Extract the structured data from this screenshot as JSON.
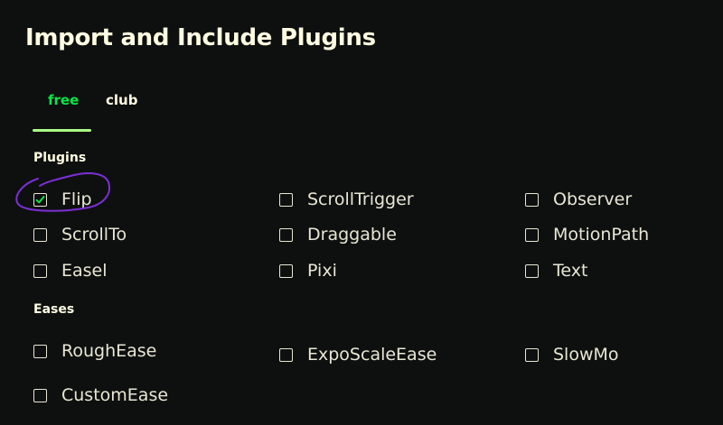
{
  "page": {
    "title": "Import and Include Plugins"
  },
  "tabs": [
    {
      "label": "free",
      "active": true
    },
    {
      "label": "club",
      "active": false
    }
  ],
  "sections": {
    "plugins": {
      "label": "Plugins",
      "items": [
        {
          "label": "Flip",
          "checked": true
        },
        {
          "label": "ScrollTrigger",
          "checked": false
        },
        {
          "label": "Observer",
          "checked": false
        },
        {
          "label": "ScrollTo",
          "checked": false
        },
        {
          "label": "Draggable",
          "checked": false
        },
        {
          "label": "MotionPath",
          "checked": false
        },
        {
          "label": "Easel",
          "checked": false
        },
        {
          "label": "Pixi",
          "checked": false
        },
        {
          "label": "Text",
          "checked": false
        }
      ]
    },
    "eases": {
      "label": "Eases",
      "items": [
        {
          "label": "RoughEase",
          "checked": false
        },
        {
          "label": "ExpoScaleEase",
          "checked": false
        },
        {
          "label": "SlowMo",
          "checked": false
        },
        {
          "label": "CustomEase",
          "checked": false
        }
      ]
    }
  },
  "colors": {
    "background": "#0e100f",
    "text": "#fffce1",
    "active_tab": "#0ae448",
    "checkmark": "#0ae448",
    "annotation": "#7b2fd6"
  },
  "icons": {
    "checkmark": "checkmark-icon",
    "annotation": "hand-drawn-circle"
  }
}
